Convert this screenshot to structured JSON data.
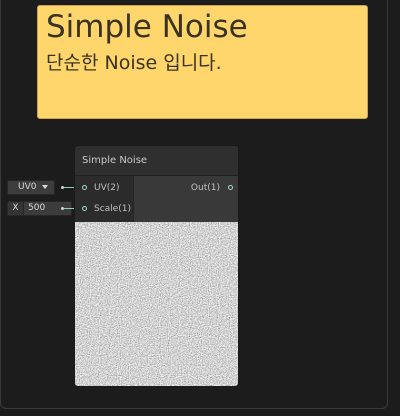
{
  "sticky_note": {
    "title": "Simple Noise",
    "body": "단순한 Noise 입니다.",
    "color": "#ffd66b"
  },
  "node": {
    "title": "Simple Noise",
    "inputs": [
      {
        "label": "UV(2)"
      },
      {
        "label": "Scale(1)"
      }
    ],
    "outputs": [
      {
        "label": "Out(1)"
      }
    ]
  },
  "controls": {
    "uv_dropdown": {
      "value": "UV0",
      "icon": "caret-down-icon"
    },
    "scale_field": {
      "axis_label": "X",
      "value": "500"
    }
  },
  "colors": {
    "port": "#9fd8c8",
    "background": "#1c1c1c"
  }
}
